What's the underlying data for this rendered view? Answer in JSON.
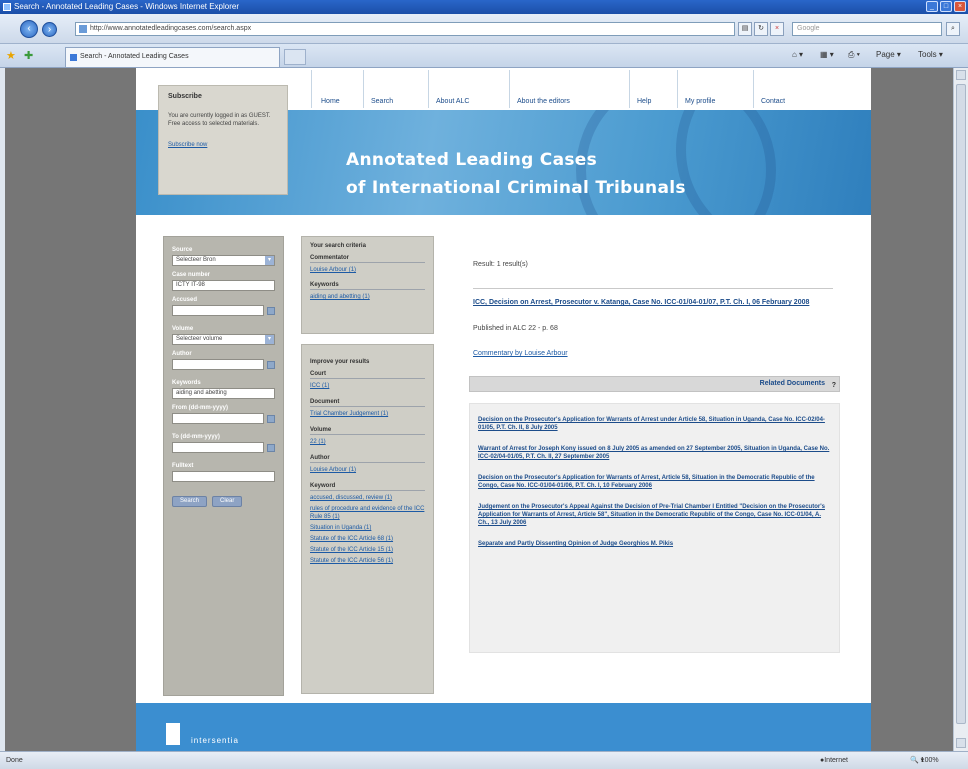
{
  "window": {
    "title": "Search - Annotated Leading Cases - Windows Internet Explorer"
  },
  "browser": {
    "address": "http://www.annotatedleadingcases.com/search.aspx",
    "search_placeholder": "Google",
    "tab_title": "Search - Annotated Leading Cases",
    "commands": [
      "Page",
      "Tools"
    ],
    "status_left": "Done",
    "status_zone": "Internet",
    "status_zoom": "100%"
  },
  "site": {
    "nav": [
      "Home",
      "Search",
      "About ALC",
      "About the editors",
      "Help",
      "My profile",
      "Contact"
    ],
    "banner_title_line1": "Annotated Leading Cases",
    "banner_title_line2": "of International Criminal Tribunals",
    "notice": {
      "heading": "Subscribe",
      "text": "You are currently logged in as GUEST. Free access to selected materials.",
      "link": "Subscribe now"
    },
    "footer_brand": "intersentia"
  },
  "search_form": {
    "labels": [
      "Source",
      "Case number",
      "Accused",
      "Volume",
      "Author",
      "Keywords",
      "From (dd-mm-yyyy)",
      "To (dd-mm-yyyy)",
      "Fulltext"
    ],
    "source_value": "Selecteer Bron",
    "case_number_value": "ICTY IT-98",
    "volume_value": "Selecteer volume",
    "keywords_value": "aiding and abetting",
    "search_button": "Search",
    "clear_button": "Clear"
  },
  "criteria": {
    "heading": "Your search criteria",
    "groups": [
      {
        "title": "Commentator",
        "items": [
          "Louise Arbour (1)"
        ]
      },
      {
        "title": "Keywords",
        "items": [
          "aiding and abetting (1)"
        ]
      }
    ]
  },
  "refine": {
    "heading": "Improve your results",
    "groups": [
      {
        "title": "Court",
        "items": [
          "ICC (1)"
        ]
      },
      {
        "title": "Document",
        "items": [
          "Trial Chamber Judgement (1)"
        ]
      },
      {
        "title": "Volume",
        "items": [
          "22 (1)"
        ]
      },
      {
        "title": "Author",
        "items": [
          "Louise Arbour (1)"
        ]
      },
      {
        "title": "Keyword",
        "items": [
          "accused, discussed, review (1)",
          "rules of procedure and evidence of the ICC Rule 85 (1)",
          "Situation in Uganda (1)",
          "Statute of the ICC Article 68 (1)",
          "Statute of the ICC Article 15 (1)",
          "Statute of the ICC Article 56 (1)"
        ]
      }
    ]
  },
  "results": {
    "count_text": "Result: 1 result(s)",
    "case_title": "ICC, Decision on Arrest, Prosecutor v. Katanga, Case No. ICC-01/04-01/07, P.T. Ch. I, 06 February 2008",
    "published": "Published in ALC 22 - p. 68",
    "commentary_link": "Commentary by Louise Arbour",
    "related_heading": "Related Documents",
    "related": [
      "Decision on the Prosecutor's Application for Warrants of Arrest under Article 58, Situation in Uganda, Case No. ICC-02/04-01/05, P.T. Ch. II, 8 July 2005",
      "Warrant of Arrest for Joseph Kony issued on 8 July 2005 as amended on 27 September 2005, Situation in Uganda, Case No. ICC-02/04-01/05, P.T. Ch. II, 27 September 2005",
      "Decision on the Prosecutor's Application for Warrants of Arrest, Article 58, Situation in the Democratic Republic of the Congo, Case No. ICC-01/04-01/06, P.T. Ch. I, 10 February 2006",
      "Judgement on the Prosecutor's Appeal Against the Decision of Pre-Trial Chamber I Entitled \"Decision on the Prosecutor's Application for Warrants of Arrest, Article 58\", Situation in the Democratic Republic of the Congo, Case No. ICC-01/04, A. Ch., 13 July 2006",
      "Separate and Partly Dissenting Opinion of Judge Georghios M. Pikis"
    ]
  }
}
